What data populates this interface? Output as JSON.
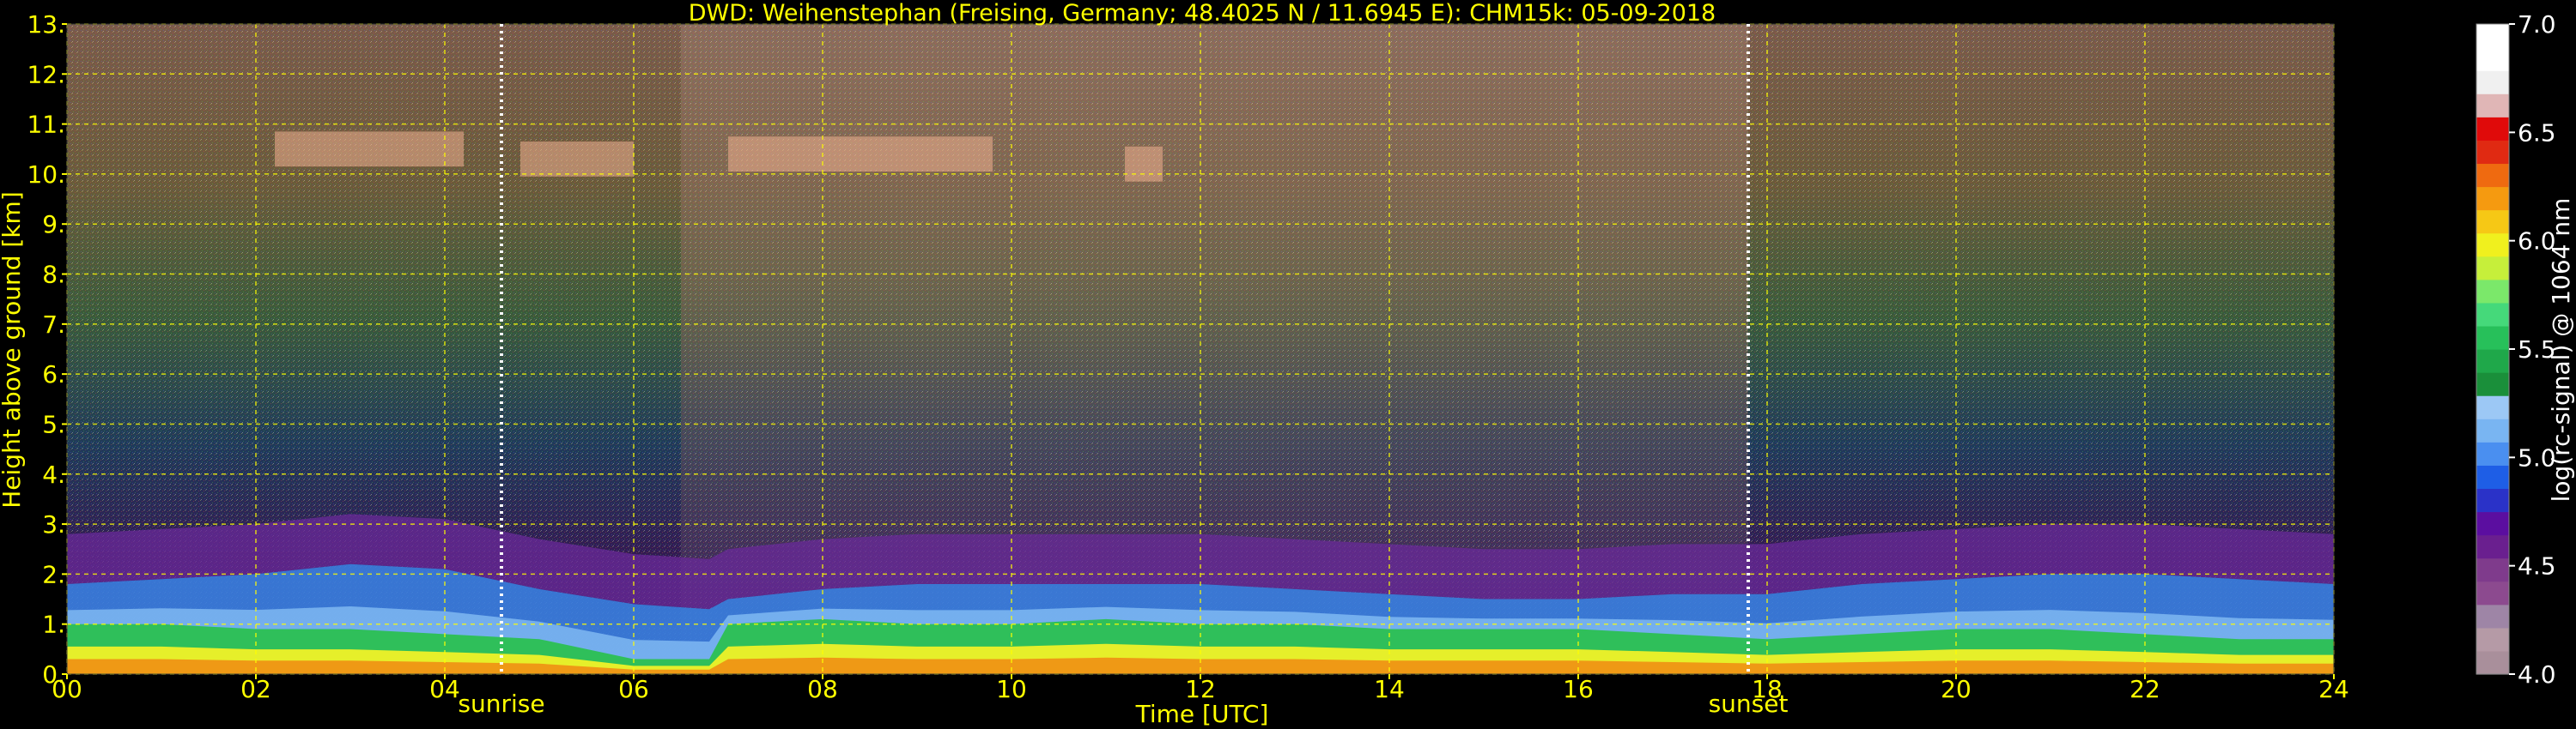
{
  "chart_data": {
    "type": "heatmap",
    "title": "DWD: Weihenstephan (Freising, Germany; 48.4025 N / 11.6945 E):    CHM15k: 05-09-2018",
    "xlabel": "Time [UTC]",
    "ylabel": "Height above ground [km]",
    "xlim": [
      0,
      24
    ],
    "ylim": [
      0,
      13
    ],
    "x_ticks": [
      "00",
      "02",
      "04",
      "06",
      "08",
      "10",
      "12",
      "14",
      "16",
      "18",
      "20",
      "22",
      "24"
    ],
    "y_ticks": [
      "0.",
      "1.",
      "2.",
      "3.",
      "4.",
      "5.",
      "6.",
      "7.",
      "8.",
      "9.",
      "10.",
      "11.",
      "12.",
      "13."
    ],
    "grid": true,
    "annotations": [
      {
        "text": "sunrise",
        "x": 4.6
      },
      {
        "text": "sunset",
        "x": 17.8
      }
    ],
    "colorbar": {
      "label": "log(rc-signal) @ 1064 nm",
      "range": [
        4.0,
        7.0
      ],
      "ticks": [
        "4.0",
        "4.5",
        "5.0",
        "5.5",
        "6.0",
        "6.5",
        "7.0"
      ],
      "colors": [
        "#a98f9b",
        "#b59aa6",
        "#9e85a6",
        "#8c4a8f",
        "#7f3b8c",
        "#6a1f8f",
        "#5b0ea0",
        "#2a32c8",
        "#1e5ee6",
        "#4a8ff0",
        "#79b5f2",
        "#9cc8f5",
        "#1a8f3a",
        "#1fa84a",
        "#27c05a",
        "#45d97a",
        "#7be86a",
        "#c6ef3a",
        "#f0f01e",
        "#f6c815",
        "#f59a10",
        "#ef6a10",
        "#e02a12",
        "#e00a0a",
        "#e0b6b6",
        "#f0f0f0",
        "#ffffff",
        "#ffffff"
      ]
    },
    "boundary_layer": {
      "x": [
        0,
        1,
        2,
        3,
        4,
        5,
        6,
        6.8,
        7,
        8,
        9,
        10,
        11,
        12,
        13,
        14,
        15,
        16,
        17,
        18,
        19,
        20,
        21,
        22,
        23,
        24
      ],
      "top_km": [
        1.8,
        1.9,
        2.0,
        2.2,
        2.1,
        1.7,
        1.4,
        1.3,
        1.5,
        1.7,
        1.8,
        1.8,
        1.8,
        1.8,
        1.7,
        1.6,
        1.5,
        1.5,
        1.6,
        1.6,
        1.8,
        1.9,
        2.0,
        2.0,
        1.9,
        1.8
      ],
      "mixed_top_km": [
        1.0,
        1.0,
        0.9,
        0.9,
        0.8,
        0.7,
        0.3,
        0.3,
        1.0,
        1.1,
        1.0,
        1.0,
        1.1,
        1.0,
        1.0,
        0.9,
        0.9,
        0.9,
        0.8,
        0.7,
        0.8,
        0.9,
        0.9,
        0.8,
        0.7,
        0.7
      ]
    },
    "cirrus_patches": [
      {
        "x_start": 2.2,
        "x_end": 4.2,
        "y_km": 10.5
      },
      {
        "x_start": 4.8,
        "x_end": 6.0,
        "y_km": 10.3
      },
      {
        "x_start": 7.0,
        "x_end": 9.8,
        "y_km": 10.4
      },
      {
        "x_start": 11.2,
        "x_end": 11.6,
        "y_km": 10.2
      }
    ],
    "colors": {
      "background": "#000000",
      "axis_text": "#ffff00",
      "grid": "#ffff00",
      "sun_lines": "#ffffff",
      "colorbar_text": "#ffffff"
    }
  }
}
